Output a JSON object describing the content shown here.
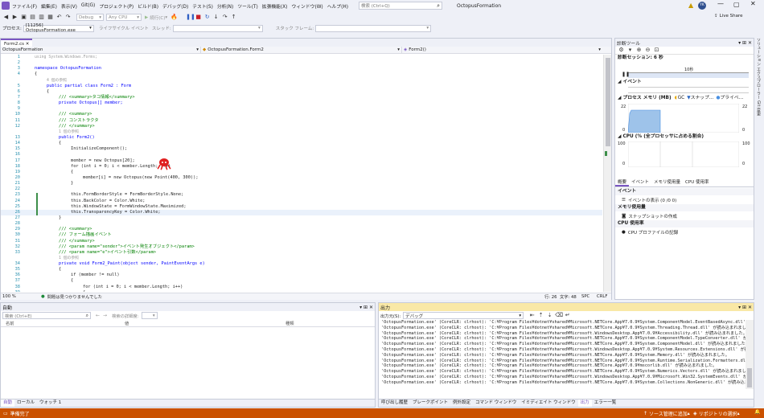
{
  "menu": {
    "items": [
      "ファイル(F)",
      "編集(E)",
      "表示(V)",
      "Git(G)",
      "プロジェクト(P)",
      "ビルド(B)",
      "デバッグ(D)",
      "テスト(S)",
      "分析(N)",
      "ツール(T)",
      "拡張機能(X)",
      "ウィンドウ(W)",
      "ヘルプ(H)"
    ],
    "search_placeholder": "検索 (Ctrl+Q)",
    "app_title": "OctopusFormation",
    "avatar": "YK",
    "live_share": "Live Share"
  },
  "toolbar": {
    "config": "Debug",
    "platform": "Any CPU",
    "continue": "続行(C)"
  },
  "toolbar2": {
    "process_label": "プロセス:",
    "process_value": "[11256] OctopusFormation.exe",
    "lifecycle": "ライフサイクル イベント",
    "thread": "スレッド:",
    "stack": "スタック フレーム:"
  },
  "editor": {
    "tab": "Form2.cs",
    "nav_project": "OctopusFormation",
    "nav_class": "OctopusFormation.Form2",
    "nav_member": "Form2()",
    "zoom": "100 %",
    "status_ok": "問題は見つかりませんでした",
    "row": "行: 26",
    "col": "文字: 48",
    "spc": "SPC",
    "crlf": "CRLF",
    "lines": [
      {
        "n": "1",
        "t": "using System.Windows.Forms;",
        "c": "gr",
        "i": 0
      },
      {
        "n": "2",
        "t": "",
        "c": "",
        "i": 0
      },
      {
        "n": "3",
        "t": "namespace OctopusFormation",
        "c": "kw",
        "i": 0
      },
      {
        "n": "4",
        "t": "{",
        "c": "",
        "i": 0
      },
      {
        "n": "",
        "t": "4 個の参照",
        "c": "gr",
        "i": 2
      },
      {
        "n": "5",
        "t": "public partial class Form2 : Form",
        "c": "kw",
        "i": 2
      },
      {
        "n": "6",
        "t": "{",
        "c": "",
        "i": 2
      },
      {
        "n": "7",
        "t": "/// <summary>タコ情報</summary>",
        "c": "cm",
        "i": 4
      },
      {
        "n": "8",
        "t": "private Octopus[] member;",
        "c": "kw",
        "i": 4
      },
      {
        "n": "9",
        "t": "",
        "c": "",
        "i": 0
      },
      {
        "n": "10",
        "t": "/// <summary>",
        "c": "cm",
        "i": 4
      },
      {
        "n": "11",
        "t": "/// コンストラクタ",
        "c": "cm",
        "i": 4
      },
      {
        "n": "12",
        "t": "/// </summary>",
        "c": "cm",
        "i": 4
      },
      {
        "n": "",
        "t": "1 個の参照",
        "c": "gr",
        "i": 4
      },
      {
        "n": "13",
        "t": "public Form2()",
        "c": "kw",
        "i": 4
      },
      {
        "n": "14",
        "t": "{",
        "c": "",
        "i": 4
      },
      {
        "n": "15",
        "t": "InitializeComponent();",
        "c": "",
        "i": 6
      },
      {
        "n": "16",
        "t": "",
        "c": "",
        "i": 0
      },
      {
        "n": "17",
        "t": "member = new Octopus[20];",
        "c": "",
        "i": 6
      },
      {
        "n": "18",
        "t": "for (int i = 0; i < member.Length; i++)",
        "c": "",
        "i": 6
      },
      {
        "n": "19",
        "t": "{",
        "c": "",
        "i": 6
      },
      {
        "n": "20",
        "t": "member[i] = new Octopus(new Point(400, 300));",
        "c": "",
        "i": 8
      },
      {
        "n": "21",
        "t": "}",
        "c": "",
        "i": 6
      },
      {
        "n": "22",
        "t": "",
        "c": "",
        "i": 0
      },
      {
        "n": "23",
        "t": "this.FormBorderStyle = FormBorderStyle.None;",
        "c": "",
        "i": 6
      },
      {
        "n": "24",
        "t": "this.BackColor = Color.White;",
        "c": "",
        "i": 6
      },
      {
        "n": "25",
        "t": "this.WindowState = FormWindowState.Maximized;",
        "c": "",
        "i": 6
      },
      {
        "n": "26",
        "t": "this.TransparencyKey = Color.White;",
        "c": "",
        "i": 6
      },
      {
        "n": "27",
        "t": "}",
        "c": "",
        "i": 4
      },
      {
        "n": "28",
        "t": "",
        "c": "",
        "i": 0
      },
      {
        "n": "29",
        "t": "/// <summary>",
        "c": "cm",
        "i": 4
      },
      {
        "n": "30",
        "t": "/// フォーム描画イベント",
        "c": "cm",
        "i": 4
      },
      {
        "n": "31",
        "t": "/// </summary>",
        "c": "cm",
        "i": 4
      },
      {
        "n": "32",
        "t": "/// <param name=\"sender\">イベント発生オブジェクト</param>",
        "c": "cm",
        "i": 4
      },
      {
        "n": "33",
        "t": "/// <param name=\"e\">イベント引数</param>",
        "c": "cm",
        "i": 4
      },
      {
        "n": "",
        "t": "1 個の参照",
        "c": "gr",
        "i": 4
      },
      {
        "n": "34",
        "t": "private void Form2_Paint(object sender, PaintEventArgs e)",
        "c": "kw",
        "i": 4
      },
      {
        "n": "35",
        "t": "{",
        "c": "",
        "i": 4
      },
      {
        "n": "36",
        "t": "if (member != null)",
        "c": "",
        "i": 6
      },
      {
        "n": "37",
        "t": "{",
        "c": "",
        "i": 6
      },
      {
        "n": "38",
        "t": "for (int i = 0; i < member.Length; i++)",
        "c": "",
        "i": 8
      },
      {
        "n": "39",
        "t": "{",
        "c": "",
        "i": 8
      }
    ]
  },
  "diagnostics": {
    "title": "診断ツール",
    "session": "診断セッション: 6 秒",
    "timeline_label": "10秒",
    "events": "イベント",
    "process_memory": "プロセス メモリ (MB)",
    "legend_gc": "GC",
    "legend_snapshot": "スナップ...",
    "legend_private": "プライベ...",
    "mem_max": "22",
    "mem_min": "0",
    "cpu": "CPU (% (全プロセッサに占める割合)",
    "cpu_max": "100",
    "cpu_min": "0",
    "tabs": [
      "概要",
      "イベント",
      "メモリ使用量",
      "CPU 使用率"
    ],
    "sec_events": "イベント",
    "show_events": "イベントの表示 (0 /0 0)",
    "sec_memory": "メモリ使用量",
    "take_snapshot": "スナップショットの作成",
    "sec_cpu": "CPU 使用率",
    "cpu_profile": "CPU プロファイルの記録",
    "side_tabs": "ソリューション エクスプローラー   Git 変更"
  },
  "autos": {
    "title": "自動",
    "search_placeholder": "検索 (Ctrl+E)",
    "depth_label": "検索の詳細度:",
    "columns": [
      "名前",
      "値",
      "種類"
    ],
    "tabs": [
      "自動",
      "ローカル",
      "ウォッチ 1"
    ]
  },
  "output": {
    "title": "出力",
    "source_label": "出力元(S):",
    "source_value": "デバッグ",
    "lines": [
      "'OctopusFormation.exe' (CoreCLR: clrhost): 'C:¥Program Files¥dotnet¥shared¥Microsoft.NETCore.App¥7.0.9¥System.ComponentModel.EventBasedAsync.dll' が読み込",
      "'OctopusFormation.exe' (CoreCLR: clrhost): 'C:¥Program Files¥dotnet¥shared¥Microsoft.NETCore.App¥7.0.9¥System.Threading.Thread.dll' が読み込まれました。",
      "'OctopusFormation.exe' (CoreCLR: clrhost): 'C:¥Program Files¥dotnet¥shared¥Microsoft.WindowsDesktop.App¥7.0.9¥Accessibility.dll' が読み込まれました。",
      "'OctopusFormation.exe' (CoreCLR: clrhost): 'C:¥Program Files¥dotnet¥shared¥Microsoft.NETCore.App¥7.0.9¥System.ComponentModel.TypeConverter.dll' が読み込",
      "'OctopusFormation.exe' (CoreCLR: clrhost): 'C:¥Program Files¥dotnet¥shared¥Microsoft.NETCore.App¥7.0.9¥System.ComponentModel.dll' が読み込まれました。",
      "'OctopusFormation.exe' (CoreCLR: clrhost): 'C:¥Program Files¥dotnet¥shared¥Microsoft.WindowsDesktop.App¥7.0.9¥System.Resources.Extensions.dll' が読み込",
      "'OctopusFormation.exe' (CoreCLR: clrhost): 'C:¥Program Files¥dotnet¥shared¥Microsoft.NETCore.App¥7.0.9¥System.Memory.dll' が読み込まれました。",
      "'OctopusFormation.exe' (CoreCLR: clrhost): 'C:¥Program Files¥dotnet¥shared¥Microsoft.NETCore.App¥7.0.9¥System.Runtime.Serialization.Formatters.dll' が読",
      "'OctopusFormation.exe' (CoreCLR: clrhost): 'C:¥Program Files¥dotnet¥shared¥Microsoft.NETCore.App¥7.0.9¥mscorlib.dll' が読み込まれました。",
      "'OctopusFormation.exe' (CoreCLR: clrhost): 'C:¥Program Files¥dotnet¥shared¥Microsoft.NETCore.App¥7.0.9¥System.Numerics.Vectors.dll' が読み込まれました。",
      "'OctopusFormation.exe' (CoreCLR: clrhost): 'C:¥Program Files¥dotnet¥shared¥Microsoft.WindowsDesktop.App¥7.0.9¥Microsoft.Win32.SystemEvents.dll' が読み込",
      "'OctopusFormation.exe' (CoreCLR: clrhost): 'C:¥Program Files¥dotnet¥shared¥Microsoft.NETCore.App¥7.0.9¥System.Collections.NonGeneric.dll' が読み込まれました。"
    ],
    "tabs": [
      "呼び出し履歴",
      "ブレークポイント",
      "例外設定",
      "コマンド ウィンドウ",
      "イミディエイト ウィンドウ",
      "出力",
      "エラー一覧"
    ]
  },
  "status": {
    "ready": "準備完了",
    "source_control": "ソース管理に追加",
    "repo": "リポジトリの選択"
  }
}
